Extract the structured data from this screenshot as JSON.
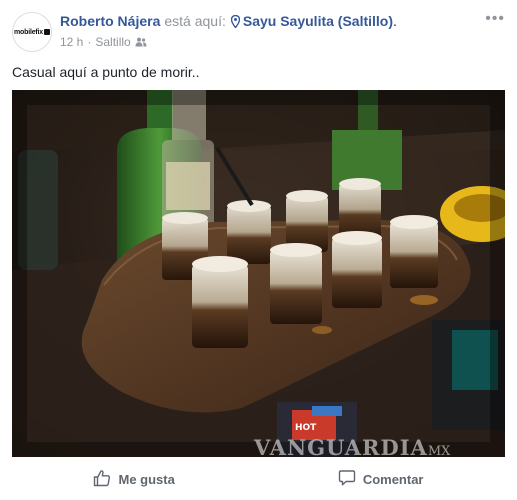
{
  "post": {
    "author": "Roberto Nájera",
    "status_text": "está aquí:",
    "location": "Sayu Sayulita (Saltillo)",
    "location_end": ".",
    "time": "12 h",
    "place": "Saltillo",
    "caption": "Casual aquí a punto de morir..",
    "avatar_text": "mobilefix",
    "more_label": "•••"
  },
  "photo": {
    "watermark": "VANGUARDIA",
    "watermark_suffix": "MX",
    "can_text": "HOT"
  },
  "actions": {
    "like_label": "Me gusta",
    "comment_label": "Comentar"
  },
  "colors": {
    "link": "#365899",
    "muted": "#90949c",
    "text": "#1d2129",
    "action": "#606770"
  }
}
